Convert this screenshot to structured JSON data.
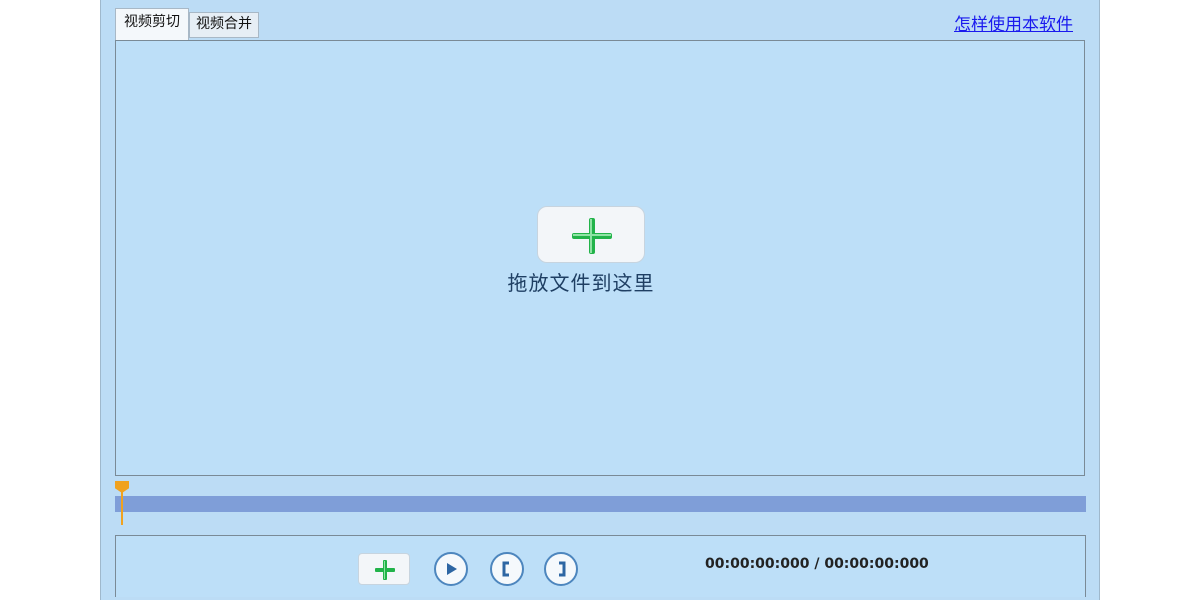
{
  "tabs": [
    {
      "label": "视频剪切",
      "active": true
    },
    {
      "label": "视频合并",
      "active": false
    }
  ],
  "help_link": "怎样使用本软件",
  "drop_area": {
    "hint": "拖放文件到这里",
    "icon": "add-plus-icon"
  },
  "timeline": {
    "position": 0,
    "marker_color": "#f0a21f",
    "track_color": "#7f9ed8"
  },
  "controls": {
    "add_icon": "add-plus-icon",
    "play_icon": "play-icon",
    "mark_in_icon": "bracket-left-icon",
    "mark_out_icon": "bracket-right-icon",
    "timecode": "00:00:00:000 / 00:00:00:000"
  },
  "colors": {
    "background": "#bcdcf5",
    "plus_green": "#22b34a",
    "button_blue": "#4d86be"
  }
}
